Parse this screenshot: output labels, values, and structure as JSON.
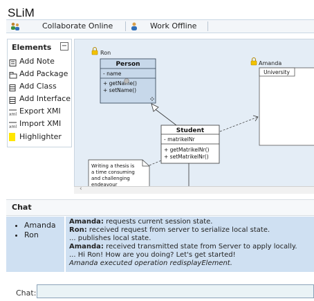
{
  "app": {
    "title": "SLiM"
  },
  "toolbar": {
    "tabs": [
      {
        "label": "Collaborate Online",
        "icon": "users-icon"
      },
      {
        "label": "Work Offline",
        "icon": "user-icon"
      }
    ]
  },
  "palette": {
    "title": "Elements",
    "toggle": "−",
    "items": [
      {
        "label": "Add Note",
        "icon": "note-icon"
      },
      {
        "label": "Add Package",
        "icon": "package-icon"
      },
      {
        "label": "Add Class",
        "icon": "class-icon"
      },
      {
        "label": "Add Interface",
        "icon": "interface-icon"
      },
      {
        "label": "Export XMI",
        "icon": "export-xmi-icon"
      },
      {
        "label": "Import XMI",
        "icon": "import-xmi-icon"
      },
      {
        "label": "Highlighter",
        "icon": "highlighter-icon",
        "color": "#ffe600"
      }
    ]
  },
  "diagram": {
    "cursors": [
      {
        "user": "Ron"
      },
      {
        "user": "Amanda"
      }
    ],
    "classes": {
      "person": {
        "name": "Person",
        "attributes": [
          "- name"
        ],
        "operations": [
          "+ getName()",
          "+ setName()"
        ]
      },
      "university": {
        "name": "University"
      },
      "student": {
        "name": "Student",
        "attributes": [
          "- matrikelNr"
        ],
        "operations": [
          "+ getMatrikelNr()",
          "+ setMatrikelNr()"
        ]
      }
    },
    "note": {
      "lines": [
        "Writing a thesis is",
        "a time consuming",
        "and challenging",
        "endeavour"
      ]
    }
  },
  "chat": {
    "header": "Chat",
    "users": [
      "Amanda",
      "Ron"
    ],
    "messages": [
      {
        "sender": "Amanda:",
        "text": " requests current session state."
      },
      {
        "sender": "Ron:",
        "text": " received request from server to serialize local state."
      },
      {
        "sender": "",
        "text": "... publishes local state."
      },
      {
        "sender": "Amanda:",
        "text": " received transmitted state from Server to apply locally."
      },
      {
        "sender": "",
        "text": "... Hi Ron! How are you doing? Let's get started!"
      },
      {
        "sender": "",
        "text": "Amanda executed operation redisplayElement.",
        "italic": true
      }
    ],
    "input_label": "Chat:",
    "input_value": ""
  },
  "colors": {
    "canvas_bg": "#e4edf6",
    "class_fill": "#c7d8ea",
    "chat_bg": "#cfe0f2",
    "highlight": "#ffe600",
    "lock": "#f2c200"
  }
}
